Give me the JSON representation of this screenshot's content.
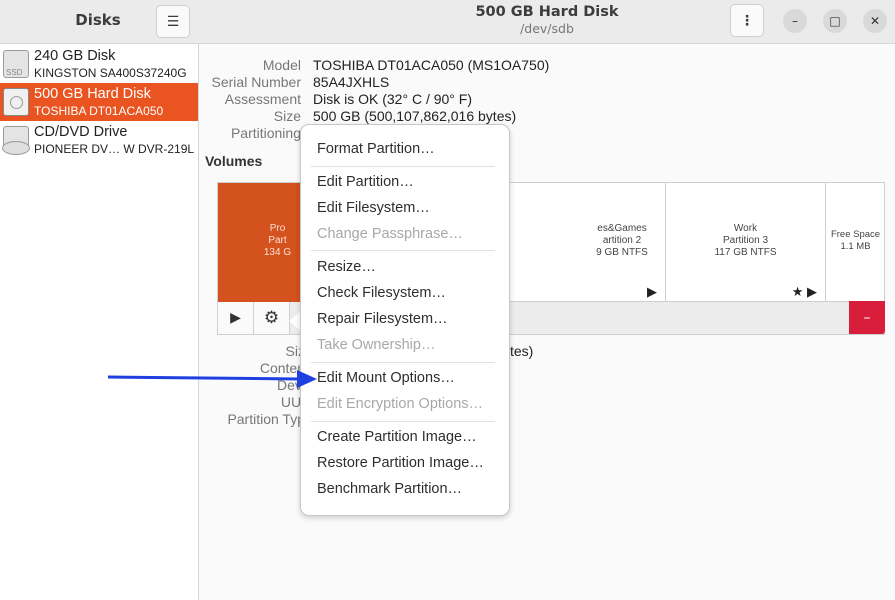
{
  "sidebar": {
    "title": "Disks",
    "menu_icon": "☰",
    "disks": [
      {
        "name": "240 GB Disk",
        "model": "KINGSTON SA400S37240G",
        "icon_label": "SSD",
        "icon": "ssd-icon"
      },
      {
        "name": "500 GB Hard Disk",
        "model": "TOSHIBA DT01ACA050",
        "icon": "hdd-icon"
      },
      {
        "name": "CD/DVD Drive",
        "model": "PIONEER DV… W  DVR-219L",
        "icon": "optical-drive-icon"
      }
    ]
  },
  "header": {
    "title": "500 GB Hard Disk",
    "subtitle": "/dev/sdb",
    "more_icon": "⋮",
    "minimize_icon": "–",
    "maximize_icon": "□",
    "close_icon": "✕"
  },
  "drive_info": {
    "model_label": "Model",
    "model": "TOSHIBA DT01ACA050 (MS1OA750)",
    "serial_label": "Serial Number",
    "serial": "85A4JXHLS",
    "assessment_label": "Assessment",
    "assessment": "Disk is OK (32° C / 90° F)",
    "size_label": "Size",
    "size": "500 GB (500,107,862,016 bytes)",
    "partitioning_label": "Partitioning"
  },
  "volumes": {
    "title": "Volumes",
    "partitions": [
      {
        "line1": "Pro",
        "line2": "Part",
        "line3": "134 G"
      },
      {
        "line1": "es&Games",
        "line2": "artition 2",
        "line3": "9 GB NTFS"
      },
      {
        "line1": "Work",
        "line2": "Partition 3",
        "line3": "117 GB NTFS"
      },
      {
        "line1": "Free Space",
        "line2": "1.1 MB"
      }
    ],
    "play_icon": "▶",
    "star_icon": "★",
    "gear_icon": "⚙",
    "delete_icon": "–"
  },
  "details": {
    "size_label": "Siz",
    "size_suffix": "tes)",
    "contents_label": "Conten",
    "device_label": "Devi",
    "uuid_label": "UUI",
    "partition_type_label": "Partition Typ"
  },
  "context_menu": {
    "items": [
      {
        "label": "Format Partition…",
        "enabled": true
      },
      {
        "label": "Edit Partition…",
        "enabled": true
      },
      {
        "label": "Edit Filesystem…",
        "enabled": true
      },
      {
        "label": "Change Passphrase…",
        "enabled": false
      },
      {
        "label": "Resize…",
        "enabled": true
      },
      {
        "label": "Check Filesystem…",
        "enabled": true
      },
      {
        "label": "Repair Filesystem…",
        "enabled": true
      },
      {
        "label": "Take Ownership…",
        "enabled": false
      },
      {
        "label": "Edit Mount Options…",
        "enabled": true
      },
      {
        "label": "Edit Encryption Options…",
        "enabled": false
      },
      {
        "label": "Create Partition Image…",
        "enabled": true
      },
      {
        "label": "Restore Partition Image…",
        "enabled": true
      },
      {
        "label": "Benchmark Partition…",
        "enabled": true
      }
    ]
  },
  "colors": {
    "accent": "#e95420",
    "selected_partition": "#d4521e",
    "delete_button": "#d81e3b",
    "annotation_arrow": "#1f3fe0"
  }
}
